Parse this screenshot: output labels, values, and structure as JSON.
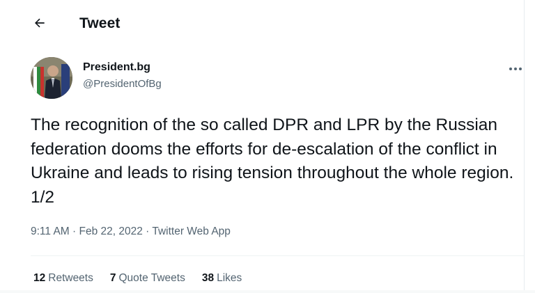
{
  "header": {
    "back_icon": "arrow-left-icon",
    "title": "Tweet"
  },
  "author": {
    "name": "President.bg",
    "handle": "@PresidentOfBg",
    "avatar_icon": "avatar-photo"
  },
  "tweet": {
    "text": "The recognition of the so called DPR and LPR by the Russian federation dooms the efforts for de-escalation of the conflict in Ukraine and leads to rising tension throughout the whole region. 1/2",
    "meta": "9:11 AM · Feb 22, 2022 · Twitter Web App",
    "more_icon": "more-horizontal-icon"
  },
  "stats": {
    "retweets_count": "12",
    "retweets_label": "Retweets",
    "quote_count": "7",
    "quote_label": "Quote Tweets",
    "likes_count": "38",
    "likes_label": "Likes"
  },
  "colors": {
    "text_primary": "#0f1419",
    "text_secondary": "#536471",
    "divider": "#eff3f4"
  }
}
